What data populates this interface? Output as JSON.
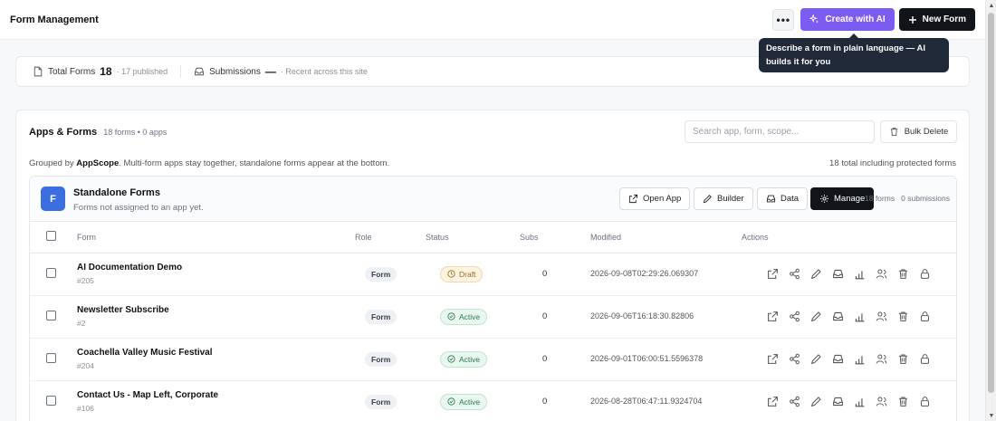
{
  "header": {
    "title": "Form Management",
    "more_label": "•••",
    "create_ai_label": "Create with AI",
    "new_form_label": "New Form"
  },
  "tooltip": {
    "text": "Describe a form in plain language — AI builds it for you"
  },
  "stats": {
    "total_forms_label": "Total Forms",
    "total_forms_value": "18",
    "total_forms_sub": "· 17 published",
    "submissions_label": "Submissions",
    "submissions_value": "—",
    "submissions_sub": "· Recent across this site"
  },
  "panel": {
    "title": "Apps & Forms",
    "meta": "18 forms • 0 apps",
    "search_placeholder": "Search app, form, scope...",
    "bulk_delete_label": "Bulk Delete",
    "grouped_prefix": "Grouped by ",
    "grouped_bold": "AppScope",
    "grouped_suffix": ". Multi-form apps stay together, standalone forms appear at the bottom.",
    "total_including": "18 total including protected forms"
  },
  "group": {
    "avatar_letter": "F",
    "name": "Standalone Forms",
    "description": "Forms not assigned to an app yet.",
    "open_app_label": "Open App",
    "builder_label": "Builder",
    "data_label": "Data",
    "manage_label": "Manage",
    "counts": "18 forms   0 submissions"
  },
  "table": {
    "columns": {
      "form": "Form",
      "role": "Role",
      "status": "Status",
      "subs": "Subs",
      "modified": "Modified",
      "actions": "Actions"
    },
    "rows": [
      {
        "name": "AI Documentation Demo",
        "id": "#205",
        "role": "Form",
        "status": "Draft",
        "subs": "0",
        "modified": "2026-09-08T02:29:26.069307"
      },
      {
        "name": "Newsletter Subscribe",
        "id": "#2",
        "role": "Form",
        "status": "Active",
        "subs": "0",
        "modified": "2026-09-06T16:18:30.82806"
      },
      {
        "name": "Coachella Valley Music Festival",
        "id": "#204",
        "role": "Form",
        "status": "Active",
        "subs": "0",
        "modified": "2026-09-01T06:00:51.5596378"
      },
      {
        "name": "Contact Us - Map Left, Corporate",
        "id": "#106",
        "role": "Form",
        "status": "Active",
        "subs": "0",
        "modified": "2026-08-28T06:47:11.9324704"
      }
    ]
  },
  "colors": {
    "accent_ai": "#7c5cf0",
    "dark_button": "#111418",
    "avatar_blue": "#3b6fe0",
    "draft": "#9a6a1a",
    "active": "#2d7a50"
  }
}
